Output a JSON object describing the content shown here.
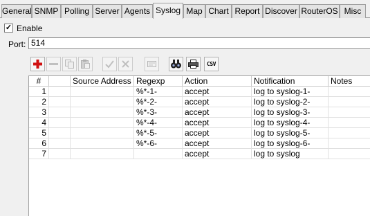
{
  "tabs": [
    {
      "label": "General",
      "active": false
    },
    {
      "label": "SNMP",
      "active": false
    },
    {
      "label": "Polling",
      "active": false
    },
    {
      "label": "Server",
      "active": false
    },
    {
      "label": "Agents",
      "active": false
    },
    {
      "label": "Syslog",
      "active": true
    },
    {
      "label": "Map",
      "active": false
    },
    {
      "label": "Chart",
      "active": false
    },
    {
      "label": "Report",
      "active": false
    },
    {
      "label": "Discover",
      "active": false
    },
    {
      "label": "RouterOS",
      "active": false
    },
    {
      "label": "Misc",
      "active": false
    }
  ],
  "enable": {
    "label": "Enable",
    "checked": true,
    "check_glyph": "✓"
  },
  "port": {
    "label": "Port:",
    "value": "514"
  },
  "toolbar": [
    {
      "icon": "add-icon",
      "enabled": true
    },
    {
      "icon": "remove-icon",
      "enabled": false
    },
    {
      "icon": "copy-icon",
      "enabled": false
    },
    {
      "icon": "paste-icon",
      "enabled": false
    },
    {
      "icon": "enable-check-icon",
      "enabled": false
    },
    {
      "icon": "disable-x-icon",
      "enabled": false
    },
    {
      "icon": "comment-icon",
      "enabled": false
    },
    {
      "icon": "find-binoculars-icon",
      "enabled": true
    },
    {
      "icon": "print-icon",
      "enabled": true
    },
    {
      "icon": "csv-export-icon",
      "enabled": true,
      "label": "CSV"
    }
  ],
  "table": {
    "columns": [
      "#",
      "",
      "Source Address",
      "Regexp",
      "Action",
      "Notification",
      "Notes"
    ],
    "rows": [
      {
        "num": "1",
        "flag": "",
        "source": "",
        "regexp": "%*-1-",
        "action": "accept",
        "notification": "log to syslog-1-",
        "notes": ""
      },
      {
        "num": "2",
        "flag": "",
        "source": "",
        "regexp": "%*-2-",
        "action": "accept",
        "notification": "log to syslog-2-",
        "notes": ""
      },
      {
        "num": "3",
        "flag": "",
        "source": "",
        "regexp": "%*-3-",
        "action": "accept",
        "notification": "log to syslog-3-",
        "notes": ""
      },
      {
        "num": "4",
        "flag": "",
        "source": "",
        "regexp": "%*-4-",
        "action": "accept",
        "notification": "log to syslog-4-",
        "notes": ""
      },
      {
        "num": "5",
        "flag": "",
        "source": "",
        "regexp": "%*-5-",
        "action": "accept",
        "notification": "log to syslog-5-",
        "notes": ""
      },
      {
        "num": "6",
        "flag": "",
        "source": "",
        "regexp": "%*-6-",
        "action": "accept",
        "notification": "log to syslog-6-",
        "notes": ""
      },
      {
        "num": "7",
        "flag": "",
        "source": "",
        "regexp": "",
        "action": "accept",
        "notification": "log to syslog",
        "notes": ""
      }
    ]
  },
  "colors": {
    "add_red": "#d01010",
    "window_bg": "#f0f0f0",
    "grid_bg": "#ffffff"
  }
}
